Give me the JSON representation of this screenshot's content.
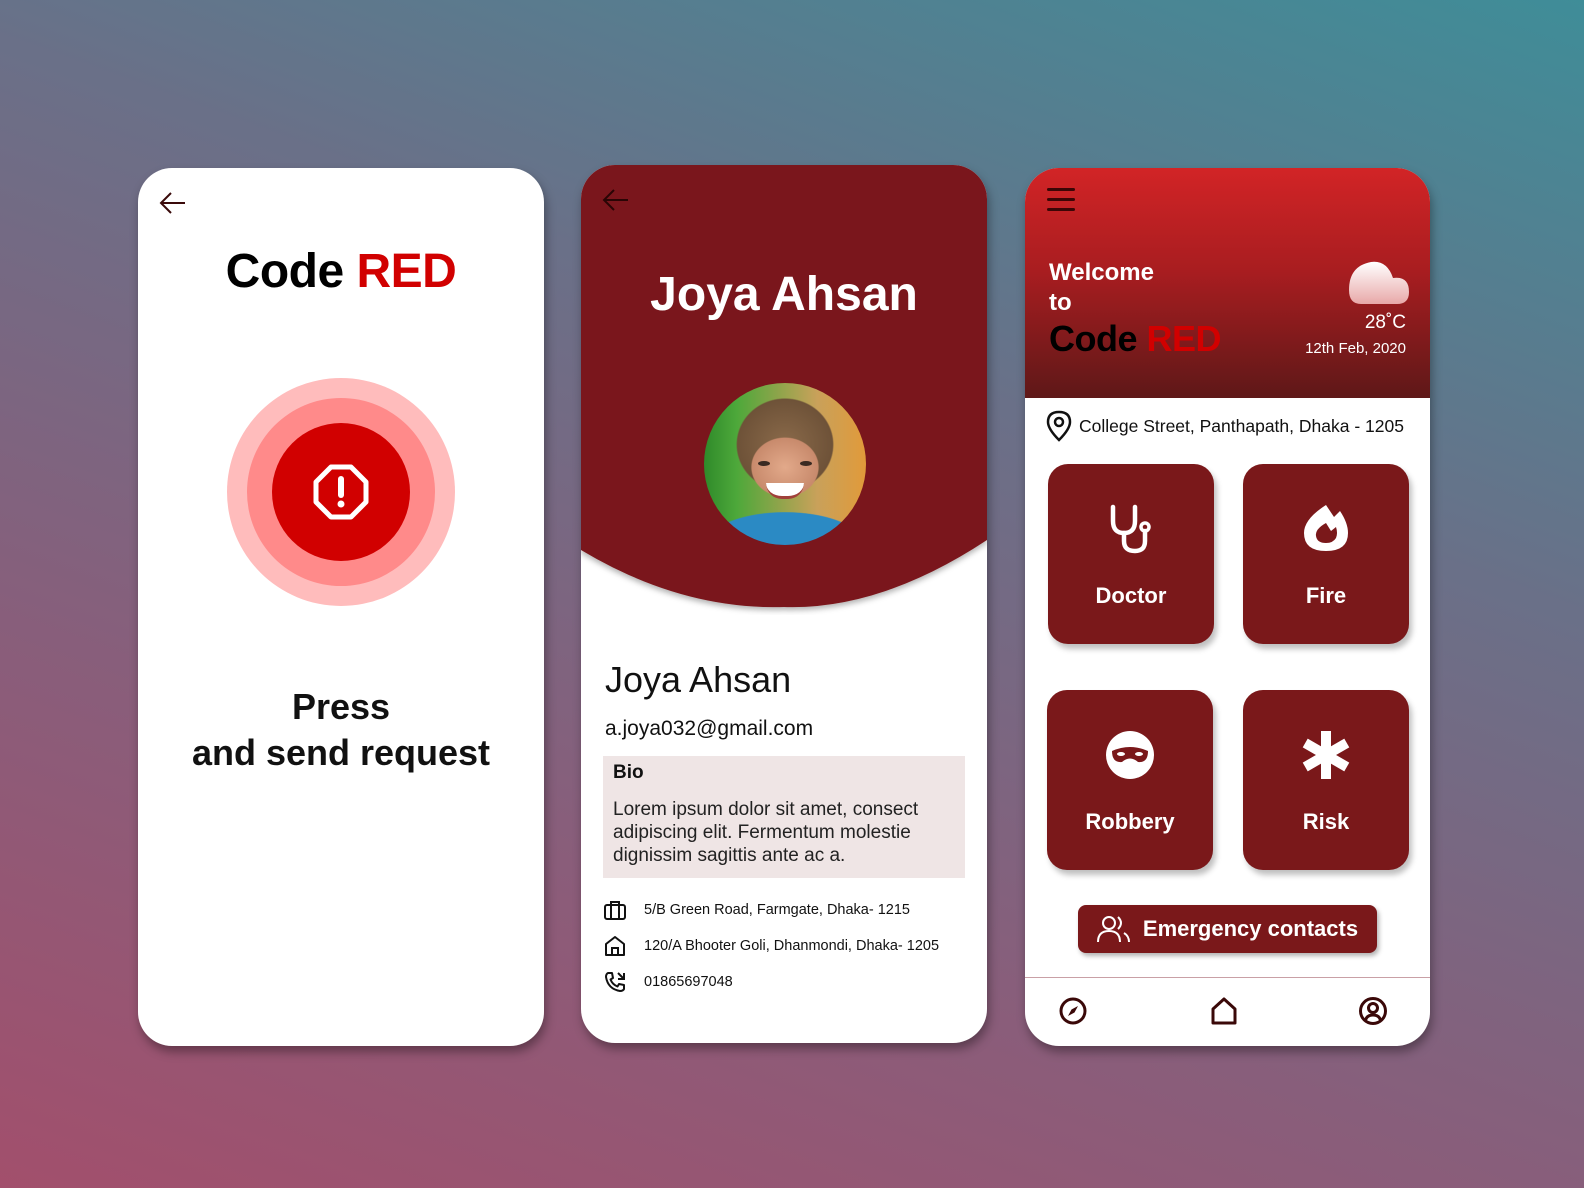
{
  "colors": {
    "brand_red": "#d10000",
    "dark_red": "#7a181a",
    "bio_bg": "#efe5e5"
  },
  "screen1": {
    "back_icon": "arrow-left-icon",
    "title_part1": "Code",
    "title_part2": "RED",
    "sos_icon": "octagon-alert-icon",
    "press_line1": "Press",
    "press_line2": "and send request"
  },
  "screen2": {
    "back_icon": "arrow-left-icon",
    "header_name": "Joya Ahsan",
    "avatar": "profile-photo",
    "name": "Joya Ahsan",
    "email": "a.joya032@gmail.com",
    "bio_label": "Bio",
    "bio_text": "Lorem ipsum dolor sit amet, consect adipiscing elit. Fermentum molestie dignissim sagittis ante ac a.",
    "info": [
      {
        "icon": "briefcase-icon",
        "text": "5/B Green Road, Farmgate, Dhaka- 1215"
      },
      {
        "icon": "home-icon",
        "text": "120/A Bhooter Goli, Dhanmondi, Dhaka- 1205"
      },
      {
        "icon": "phone-call-icon",
        "text": "01865697048"
      }
    ]
  },
  "screen3": {
    "menu_icon": "hamburger-icon",
    "welcome_line1": "Welcome",
    "welcome_line2": "to",
    "title_part1": "Code",
    "title_part2": "RED",
    "weather_icon": "cloud-icon",
    "temperature": "28˚C",
    "date": "12th Feb, 2020",
    "location": "College Street, Panthapath, Dhaka - 1205",
    "tiles": [
      {
        "label": "Doctor",
        "icon": "stethoscope-icon"
      },
      {
        "label": "Fire",
        "icon": "fire-icon"
      },
      {
        "label": "Robbery",
        "icon": "mask-icon"
      },
      {
        "label": "Risk",
        "icon": "asterisk-icon"
      }
    ],
    "emergency_button": "Emergency contacts",
    "nav": [
      {
        "icon": "compass-icon"
      },
      {
        "icon": "home-icon"
      },
      {
        "icon": "user-circle-icon"
      }
    ]
  }
}
